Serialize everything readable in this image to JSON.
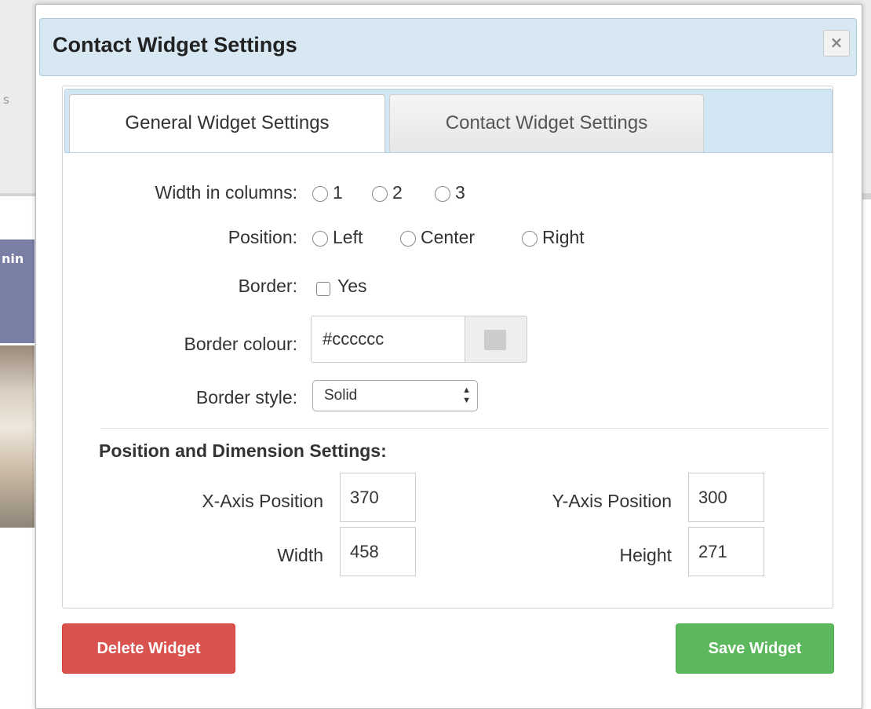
{
  "background": {
    "top_text": "s",
    "band_text": "nin"
  },
  "modal": {
    "title": "Contact Widget Settings",
    "close_icon": "×"
  },
  "tabs": [
    {
      "label": "General Widget Settings",
      "active": true
    },
    {
      "label": "Contact Widget Settings",
      "active": false
    }
  ],
  "general": {
    "width_label": "Width in columns:",
    "width_options": [
      "1",
      "2",
      "3"
    ],
    "position_label": "Position:",
    "position_options": [
      "Left",
      "Center",
      "Right"
    ],
    "border_label": "Border:",
    "border_option": "Yes",
    "border_colour_label": "Border colour:",
    "border_colour_value": "#cccccc",
    "border_style_label": "Border style:",
    "border_style_value": "Solid"
  },
  "dimensions": {
    "section_title": "Position and Dimension Settings:",
    "x_label": "X-Axis Position",
    "x_value": "370",
    "y_label": "Y-Axis Position",
    "y_value": "300",
    "width_label": "Width",
    "width_value": "458",
    "height_label": "Height",
    "height_value": "271"
  },
  "buttons": {
    "delete": "Delete Widget",
    "save": "Save Widget"
  },
  "colors": {
    "header_bg": "#d7e8f3",
    "delete_bg": "#d9534f",
    "save_bg": "#5cb85c",
    "swatch": "#cccccc"
  }
}
